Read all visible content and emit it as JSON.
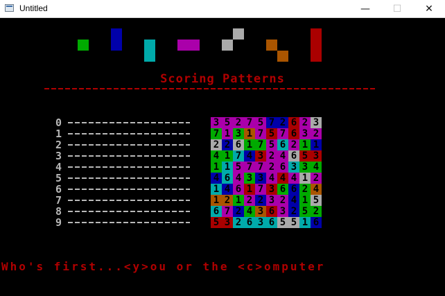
{
  "window": {
    "title": "Untitled",
    "min_glyph": "—",
    "max_glyph": "☐",
    "close_glyph": "✕"
  },
  "colors": {
    "G": "#00aa00",
    "B": "#0000aa",
    "C": "#00aaaa",
    "M": "#aa00aa",
    "W": "#aaaaaa",
    "O": "#aa5500",
    "R": "#aa0000"
  },
  "heading": "Scoring Patterns",
  "pattern_labels": [
    "0",
    "1",
    "2",
    "3",
    "4",
    "5",
    "6",
    "7",
    "8",
    "9"
  ],
  "grid": [
    [
      [
        "3",
        "M"
      ],
      [
        "5",
        "M"
      ],
      [
        "2",
        "M"
      ],
      [
        "7",
        "M"
      ],
      [
        "5",
        "M"
      ],
      [
        "7",
        "B"
      ],
      [
        "2",
        "B"
      ],
      [
        "6",
        "R"
      ],
      [
        "2",
        "M"
      ],
      [
        "3",
        "W"
      ]
    ],
    [
      [
        "7",
        "G"
      ],
      [
        "1",
        "M"
      ],
      [
        "3",
        "G"
      ],
      [
        "1",
        "O"
      ],
      [
        "7",
        "M"
      ],
      [
        "5",
        "R"
      ],
      [
        "7",
        "M"
      ],
      [
        "6",
        "R"
      ],
      [
        "3",
        "M"
      ],
      [
        "2",
        "M"
      ]
    ],
    [
      [
        "2",
        "W"
      ],
      [
        "2",
        "B"
      ],
      [
        "6",
        "W"
      ],
      [
        "1",
        "G"
      ],
      [
        "7",
        "G"
      ],
      [
        "5",
        "M"
      ],
      [
        "6",
        "C"
      ],
      [
        "2",
        "M"
      ],
      [
        "1",
        "G"
      ],
      [
        "1",
        "B"
      ]
    ],
    [
      [
        "4",
        "G"
      ],
      [
        "1",
        "G"
      ],
      [
        "7",
        "C"
      ],
      [
        "4",
        "B"
      ],
      [
        "3",
        "R"
      ],
      [
        "2",
        "M"
      ],
      [
        "4",
        "M"
      ],
      [
        "6",
        "W"
      ],
      [
        "5",
        "R"
      ],
      [
        "3",
        "R"
      ]
    ],
    [
      [
        "1",
        "G"
      ],
      [
        "1",
        "C"
      ],
      [
        "5",
        "M"
      ],
      [
        "7",
        "M"
      ],
      [
        "7",
        "M"
      ],
      [
        "2",
        "M"
      ],
      [
        "6",
        "M"
      ],
      [
        "3",
        "C"
      ],
      [
        "3",
        "G"
      ],
      [
        "4",
        "G"
      ]
    ],
    [
      [
        "4",
        "B"
      ],
      [
        "6",
        "C"
      ],
      [
        "4",
        "M"
      ],
      [
        "3",
        "G"
      ],
      [
        "3",
        "B"
      ],
      [
        "4",
        "M"
      ],
      [
        "4",
        "R"
      ],
      [
        "4",
        "M"
      ],
      [
        "1",
        "W"
      ],
      [
        "2",
        "M"
      ]
    ],
    [
      [
        "1",
        "C"
      ],
      [
        "4",
        "B"
      ],
      [
        "6",
        "M"
      ],
      [
        "1",
        "R"
      ],
      [
        "7",
        "M"
      ],
      [
        "3",
        "R"
      ],
      [
        "6",
        "G"
      ],
      [
        "6",
        "B"
      ],
      [
        "2",
        "G"
      ],
      [
        "4",
        "O"
      ]
    ],
    [
      [
        "1",
        "O"
      ],
      [
        "2",
        "O"
      ],
      [
        "1",
        "G"
      ],
      [
        "2",
        "M"
      ],
      [
        "2",
        "B"
      ],
      [
        "3",
        "M"
      ],
      [
        "2",
        "M"
      ],
      [
        "4",
        "B"
      ],
      [
        "1",
        "G"
      ],
      [
        "5",
        "W"
      ]
    ],
    [
      [
        "6",
        "C"
      ],
      [
        "7",
        "M"
      ],
      [
        "2",
        "B"
      ],
      [
        "4",
        "G"
      ],
      [
        "3",
        "O"
      ],
      [
        "6",
        "R"
      ],
      [
        "3",
        "M"
      ],
      [
        "2",
        "B"
      ],
      [
        "5",
        "G"
      ],
      [
        "2",
        "G"
      ]
    ],
    [
      [
        "5",
        "R"
      ],
      [
        "3",
        "R"
      ],
      [
        "2",
        "C"
      ],
      [
        "6",
        "C"
      ],
      [
        "3",
        "C"
      ],
      [
        "6",
        "C"
      ],
      [
        "5",
        "W"
      ],
      [
        "5",
        "W"
      ],
      [
        "1",
        "C"
      ],
      [
        "6",
        "B"
      ]
    ]
  ],
  "prompt": "Who's first...<y>ou or the <c>omputer"
}
